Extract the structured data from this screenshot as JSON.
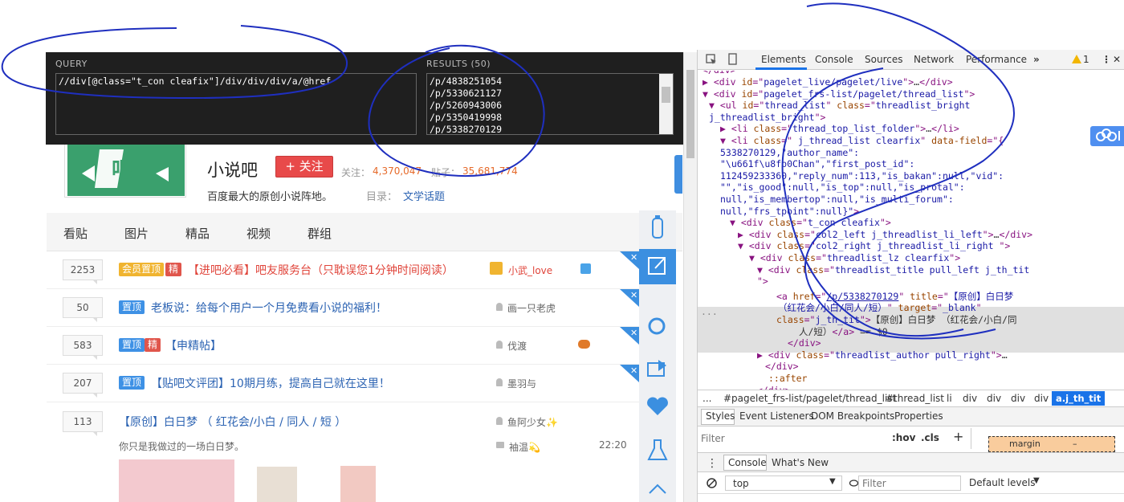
{
  "xpath_helper": {
    "query_label": "QUERY",
    "query": "//div[@class=\"t_con cleafix\"]/div/div/div/a/@href",
    "results_label": "RESULTS (50)",
    "results": [
      "/p/4838251054",
      "/p/5330621127",
      "/p/5260943006",
      "/p/5350419998",
      "/p/5338270129"
    ]
  },
  "forum": {
    "name": "小说吧",
    "follow_button": "+ 关注",
    "follow_label": "关注：",
    "follow_count": "4,370,047",
    "post_label": "贴子：",
    "post_count": "35,681,774",
    "description": "百度最大的原创小说阵地。",
    "catalog_label": "目录：",
    "catalog_value": "文学话题"
  },
  "tabs": [
    "看贴",
    "图片",
    "精品",
    "视频",
    "群组"
  ],
  "threads": [
    {
      "replies": "2253",
      "badges": [
        "会员置顶",
        "精"
      ],
      "title": "【进吧必看】吧友服务台（只耽误您1分钟时间阅读）",
      "author": "小武_love",
      "title_red": true
    },
    {
      "replies": "50",
      "badges": [
        "置顶"
      ],
      "title": "老板说：给每个用户一个月免费看小说的福利！",
      "author": "画一只老虎",
      "title_red": false
    },
    {
      "replies": "583",
      "badges": [
        "置顶",
        "精"
      ],
      "title": "【申精帖】",
      "author": "伐渡",
      "title_red": false
    },
    {
      "replies": "207",
      "badges": [
        "置顶"
      ],
      "title": "【贴吧文评团】10期月练，提高自己就在这里！",
      "author": "墨羽与",
      "title_red": false
    },
    {
      "replies": "113",
      "badges": [],
      "title": "【原创】白日梦 （ 红花会/小白 / 同人 / 短 ）",
      "author": "鱼阿少女✨",
      "title_red": false
    }
  ],
  "thread5_extra": {
    "excerpt": "你只是我做过的一场白日梦。",
    "last_reply_author": "袖温💫",
    "time": "22:20"
  },
  "devtools": {
    "tabs": [
      "Elements",
      "Console",
      "Sources",
      "Network",
      "Performance"
    ],
    "more": "»",
    "warning_count": "1",
    "dom_lines": [
      {
        "parts": [
          [
            "tg",
            "▶ <div "
          ],
          [
            "an",
            "id"
          ],
          [
            "tg",
            "=\""
          ],
          [
            "av",
            "pagelet_live/pagelet/live"
          ],
          [
            "tg",
            "\">"
          ],
          [
            "tx",
            "…"
          ],
          [
            "tg",
            "</div>"
          ]
        ]
      },
      {
        "parts": [
          [
            "tg",
            "▼ <div "
          ],
          [
            "an",
            "id"
          ],
          [
            "tg",
            "=\""
          ],
          [
            "av",
            "pagelet_frs-list/pagelet/thread_list"
          ],
          [
            "tg",
            "\">"
          ]
        ]
      },
      {
        "parts": [
          [
            "tg",
            "▼ <ul "
          ],
          [
            "an",
            "id"
          ],
          [
            "tg",
            "=\""
          ],
          [
            "av",
            "thread_list"
          ],
          [
            "tg",
            "\" "
          ],
          [
            "an",
            "class"
          ],
          [
            "tg",
            "=\""
          ],
          [
            "av",
            "threadlist_bright"
          ]
        ]
      },
      {
        "parts": [
          [
            "av",
            "j_threadlist_bright"
          ],
          [
            "tg",
            "\">"
          ]
        ]
      },
      {
        "parts": [
          [
            "tg",
            "▶ <li "
          ],
          [
            "an",
            "class"
          ],
          [
            "tg",
            "=\""
          ],
          [
            "av",
            "thread_top_list_folder"
          ],
          [
            "tg",
            "\">"
          ],
          [
            "tx",
            "…"
          ],
          [
            "tg",
            "</li>"
          ]
        ]
      },
      {
        "parts": [
          [
            "tg",
            "▼ <li "
          ],
          [
            "an",
            "class"
          ],
          [
            "tg",
            "=\""
          ],
          [
            "av",
            " j_thread_list clearfix"
          ],
          [
            "tg",
            "\" "
          ],
          [
            "an",
            "data-field"
          ],
          [
            "tg",
            "=\"{"
          ]
        ]
      },
      {
        "parts": [
          [
            "av",
            "5338270129,\"author_name\":"
          ]
        ]
      },
      {
        "parts": [
          [
            "av",
            "\"\\u661f\\u8fb0Chan\",\"first_post_id\":"
          ]
        ]
      },
      {
        "parts": [
          [
            "av",
            "112459233360,\"reply_num\":113,\"is_bakan\":null,\"vid\":"
          ]
        ]
      },
      {
        "parts": [
          [
            "av",
            "\"\",\"is_good\":null,\"is_top\":null,\"is_protal\":"
          ]
        ]
      },
      {
        "parts": [
          [
            "av",
            "null,\"is_membertop\":null,\"is_multi_forum\":"
          ]
        ]
      },
      {
        "parts": [
          [
            "av",
            "null,\"frs_tpoint\":null}\""
          ],
          [
            "tg",
            ">"
          ]
        ]
      },
      {
        "parts": [
          [
            "tg",
            "▼ <div "
          ],
          [
            "an",
            "class"
          ],
          [
            "tg",
            "=\""
          ],
          [
            "av",
            "t_con cleafix"
          ],
          [
            "tg",
            "\">"
          ]
        ]
      },
      {
        "parts": [
          [
            "tg",
            "▶ <div "
          ],
          [
            "an",
            "class"
          ],
          [
            "tg",
            "=\""
          ],
          [
            "av",
            "col2_left j_threadlist_li_left"
          ],
          [
            "tg",
            "\">"
          ],
          [
            "tx",
            "…"
          ],
          [
            "tg",
            "</div>"
          ]
        ]
      },
      {
        "parts": [
          [
            "tg",
            "▼ <div "
          ],
          [
            "an",
            "class"
          ],
          [
            "tg",
            "=\""
          ],
          [
            "av",
            "col2_right j_threadlist_li_right "
          ],
          [
            "tg",
            "\">"
          ]
        ]
      },
      {
        "parts": [
          [
            "tg",
            "▼ <div "
          ],
          [
            "an",
            "class"
          ],
          [
            "tg",
            "=\""
          ],
          [
            "av",
            "threadlist_lz clearfix"
          ],
          [
            "tg",
            "\">"
          ]
        ]
      },
      {
        "parts": [
          [
            "tg",
            "▼ <div "
          ],
          [
            "an",
            "class"
          ],
          [
            "tg",
            "=\""
          ],
          [
            "av",
            "threadlist_title pull_left j_th_tit"
          ]
        ]
      },
      {
        "parts": [
          [
            "tg",
            "\">"
          ]
        ]
      },
      {
        "parts": [
          [
            "tg",
            "<a "
          ],
          [
            "an",
            "href"
          ],
          [
            "tg",
            "=\""
          ],
          [
            "lk",
            "/p/5338270129"
          ],
          [
            "tg",
            "\" "
          ],
          [
            "an",
            "title"
          ],
          [
            "tg",
            "=\""
          ],
          [
            "av",
            "【原创】白日梦"
          ]
        ]
      },
      {
        "parts": [
          [
            "av",
            "（红花会/小白/同人/短）"
          ],
          [
            "tg",
            "\" "
          ],
          [
            "an",
            "target"
          ],
          [
            "tg",
            "=\""
          ],
          [
            "av",
            "_blank"
          ],
          [
            "tg",
            "\""
          ]
        ]
      },
      {
        "parts": [
          [
            "an",
            "class"
          ],
          [
            "tg",
            "=\""
          ],
          [
            "av",
            "j_th_tit"
          ],
          [
            "tg",
            "\">"
          ],
          [
            "tx",
            "【原创】白日梦 （红花会/小白/同"
          ]
        ]
      },
      {
        "parts": [
          [
            "tx",
            "人/短）"
          ],
          [
            "tg",
            "</a>"
          ],
          [
            "tx",
            " == $0"
          ]
        ]
      },
      {
        "parts": [
          [
            "tg",
            "</div>"
          ]
        ]
      },
      {
        "parts": [
          [
            "tg",
            "▶ <div "
          ],
          [
            "an",
            "class"
          ],
          [
            "tg",
            "=\""
          ],
          [
            "av",
            "threadlist_author pull_right"
          ],
          [
            "tg",
            "\">"
          ],
          [
            "tx",
            "…"
          ]
        ]
      },
      {
        "parts": [
          [
            "tg",
            "</div>"
          ]
        ]
      },
      {
        "parts": [
          [
            "an",
            "::after"
          ]
        ]
      },
      {
        "parts": [
          [
            "tg",
            "</div>"
          ]
        ]
      }
    ],
    "breadcrumbs": [
      "...",
      "#pagelet_frs-list/pagelet/thread_list",
      "#thread_list",
      "li",
      "div",
      "div",
      "div",
      "div"
    ],
    "breadcrumb_active": "a.j_th_tit",
    "styles_tabs": [
      "Styles",
      "Event Listeners",
      "DOM Breakpoints",
      "Properties"
    ],
    "filter_placeholder": "Filter",
    "hov": ":hov",
    "cls": ".cls",
    "plus": "+",
    "box_model": "margin",
    "box_dash": "–",
    "drawer_tabs": [
      "Console",
      "What's New"
    ],
    "context": "top",
    "console_filter": "Filter",
    "levels": "Default levels"
  },
  "colors": {
    "accent_blue": "#1a73e8",
    "forum_green": "#3aa06d",
    "follow_red": "#e84a4a",
    "annotation_ink": "#1f2fbf"
  }
}
